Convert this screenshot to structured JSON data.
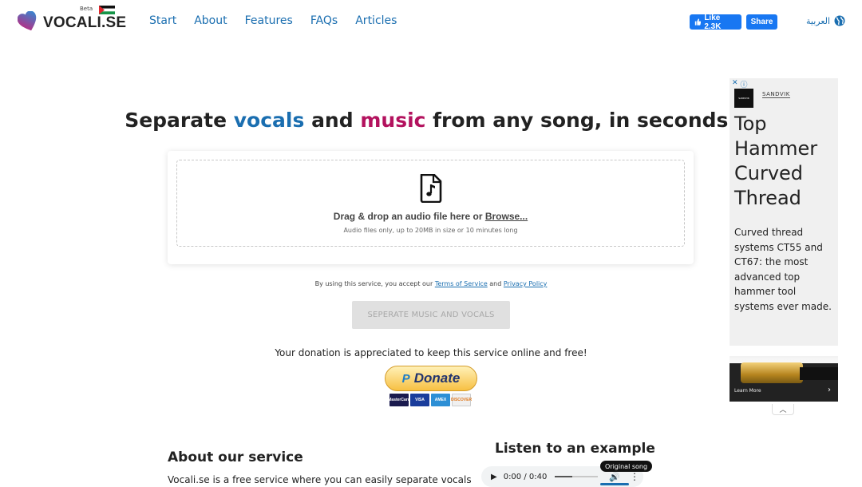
{
  "header": {
    "logo_text": "VOCALI.SE",
    "beta_label": "Beta",
    "nav": [
      "Start",
      "About",
      "Features",
      "FAQs",
      "Articles"
    ],
    "fb_like_label": "Like 2.3K",
    "fb_share_label": "Share",
    "language_label": "العربية"
  },
  "hero": {
    "headline_part1": "Separate ",
    "headline_vocals": "vocals",
    "headline_part2": " and ",
    "headline_music": "music",
    "headline_part3": " from any song, in seconds!"
  },
  "upload": {
    "drop_text": "Drag & drop an audio file here or ",
    "browse_label": "Browse...",
    "sub_text": "Audio files only, up to 20MB in size or 10 minutes long"
  },
  "terms": {
    "prefix": "By using this service, you accept our ",
    "terms_link": "Terms of Service",
    "middle": " and ",
    "privacy_link": "Privacy Policy"
  },
  "actions": {
    "separate_button": "SEPERATE MUSIC AND VOCALS"
  },
  "donation": {
    "text": "Your donation is appreciated to keep this service online and free!",
    "button_label": "Donate",
    "paypal_mark": "P",
    "cards": [
      "MasterCard",
      "VISA",
      "AMEX",
      "DISCOVER"
    ]
  },
  "about": {
    "title": "About our service",
    "text": "Vocali.se is a free service where you can easily separate vocals"
  },
  "example": {
    "title": "Listen to an example",
    "time": "0:00 / 0:40",
    "tag": "Original song"
  },
  "ad": {
    "brand": "SANDVIK",
    "logo_text": "SANDVIK",
    "headline": "Top Hammer Curved Thread",
    "body": "Curved thread systems CT55 and CT67: the most advanced top hammer tool systems ever made.",
    "learn_more": "Learn More"
  },
  "colors": {
    "accent_blue": "#1a6eb0",
    "accent_pink": "#b3125e",
    "facebook": "#1877f2"
  }
}
